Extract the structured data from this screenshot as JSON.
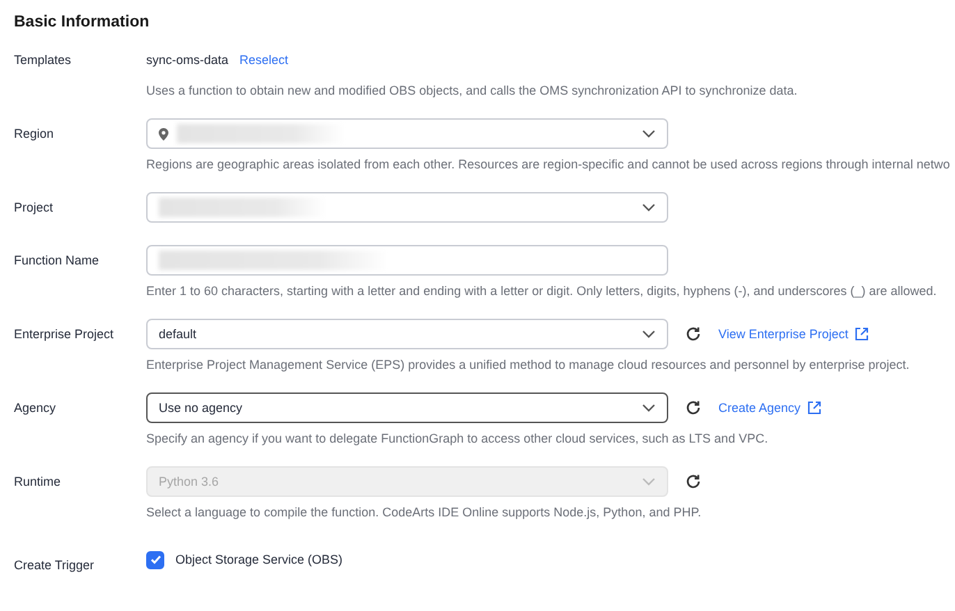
{
  "section": {
    "title": "Basic Information"
  },
  "fields": [
    {
      "kind": "text",
      "label": "Templates",
      "value": "sync-oms-data",
      "link": "Reselect",
      "description": "Uses a function to obtain new and modified OBS objects, and calls the OMS synchronization API to synchronize data."
    },
    {
      "kind": "location-select",
      "label": "Region",
      "redacted": true,
      "description": "Regions are geographic areas isolated from each other. Resources are region-specific and cannot be used across regions through internal netwo"
    },
    {
      "kind": "select",
      "label": "Project",
      "redacted": true
    },
    {
      "kind": "input",
      "label": "Function Name",
      "redacted": true,
      "description": "Enter 1 to 60 characters, starting with a letter and ending with a letter or digit. Only letters, digits, hyphens (-), and underscores (_) are allowed."
    },
    {
      "kind": "select",
      "label": "Enterprise Project",
      "value": "default",
      "refresh": true,
      "external_link": "View Enterprise Project",
      "description": "Enterprise Project Management Service (EPS) provides a unified method to manage cloud resources and personnel by enterprise project."
    },
    {
      "kind": "select",
      "label": "Agency",
      "value": "Use no agency",
      "focused": true,
      "refresh": true,
      "external_link": "Create Agency",
      "description": "Specify an agency if you want to delegate FunctionGraph to access other cloud services, such as LTS and VPC."
    },
    {
      "kind": "select",
      "label": "Runtime",
      "value": "Python 3.6",
      "disabled": true,
      "refresh": true,
      "description": "Select a language to compile the function. CodeArts IDE Online supports Node.js, Python, and PHP."
    },
    {
      "kind": "checkbox",
      "label": "Create Trigger",
      "option": "Object Storage Service (OBS)",
      "checked": true
    }
  ]
}
